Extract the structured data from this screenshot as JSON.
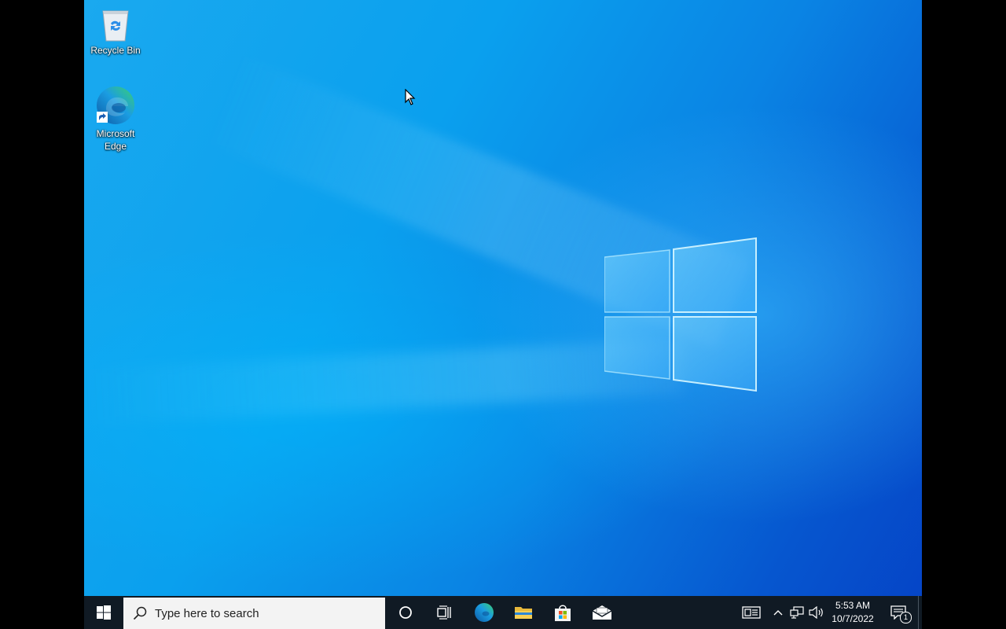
{
  "desktop": {
    "icons": [
      {
        "label": "Recycle Bin",
        "icon": "recycle-bin-icon"
      },
      {
        "label": "Microsoft Edge",
        "label_line1": "Microsoft",
        "label_line2": "Edge",
        "icon": "edge-icon"
      }
    ]
  },
  "taskbar": {
    "search": {
      "placeholder": "Type here to search"
    },
    "pinned": [
      "cortana-icon",
      "task-view-icon",
      "edge-icon",
      "file-explorer-icon",
      "microsoft-store-icon",
      "mail-icon"
    ],
    "tray": {
      "icons": [
        "news-and-interests-icon",
        "show-hidden-icons-chevron",
        "network-icon",
        "volume-icon"
      ],
      "time": "5:53 AM",
      "date": "10/7/2022",
      "notification_count": "1"
    }
  },
  "colors": {
    "taskbar": "#101a24",
    "desktop_accent": "#0a84e4",
    "search_box": "#f3f3f3"
  }
}
